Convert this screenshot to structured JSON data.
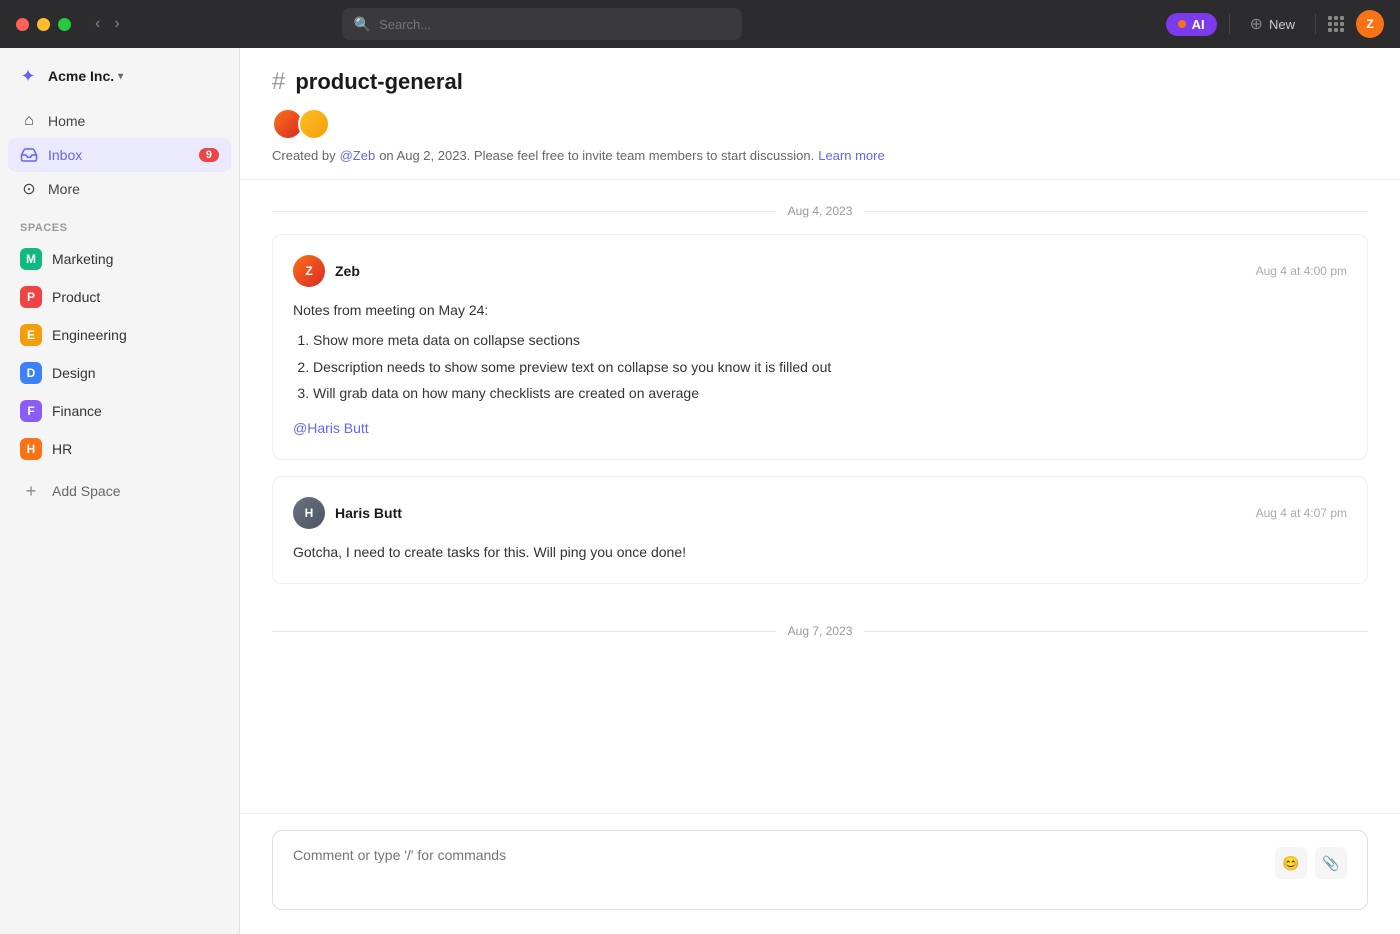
{
  "titlebar": {
    "search_placeholder": "Search...",
    "ai_label": "AI",
    "new_label": "New"
  },
  "sidebar": {
    "workspace_name": "Acme Inc.",
    "nav_items": [
      {
        "id": "home",
        "label": "Home",
        "icon": "house"
      },
      {
        "id": "inbox",
        "label": "Inbox",
        "icon": "inbox",
        "badge": "9",
        "active": true
      },
      {
        "id": "more",
        "label": "More",
        "icon": "more"
      }
    ],
    "spaces_label": "Spaces",
    "spaces": [
      {
        "id": "marketing",
        "label": "Marketing",
        "initial": "M",
        "color": "marketing"
      },
      {
        "id": "product",
        "label": "Product",
        "initial": "P",
        "color": "product"
      },
      {
        "id": "engineering",
        "label": "Engineering",
        "initial": "E",
        "color": "engineering"
      },
      {
        "id": "design",
        "label": "Design",
        "initial": "D",
        "color": "design"
      },
      {
        "id": "finance",
        "label": "Finance",
        "initial": "F",
        "color": "finance"
      },
      {
        "id": "hr",
        "label": "HR",
        "initial": "H",
        "color": "hr"
      }
    ],
    "add_space_label": "Add Space"
  },
  "channel": {
    "name": "product-general",
    "meta_created_by": "Created by ",
    "meta_mention": "@Zeb",
    "meta_on": " on Aug 2, 2023. Please feel free to invite team members to start discussion. ",
    "meta_learn_more": "Learn more"
  },
  "date_groups": [
    {
      "date": "Aug 4, 2023",
      "messages": [
        {
          "author": "Zeb",
          "time": "Aug 4 at 4:00 pm",
          "avatar_class": "zeb-avatar",
          "body_intro": "Notes from meeting on May 24:",
          "list_items": [
            "Show more meta data on collapse sections",
            "Description needs to show some preview text on collapse so you know it is filled out",
            "Will grab data on how many checklists are created on average"
          ],
          "mention": "@Haris Butt",
          "plain_body": null
        },
        {
          "author": "Haris Butt",
          "time": "Aug 4 at 4:07 pm",
          "avatar_class": "haris-avatar",
          "body_intro": null,
          "list_items": [],
          "mention": null,
          "plain_body": "Gotcha, I need to create tasks for this. Will ping you once done!"
        }
      ]
    },
    {
      "date": "Aug 7, 2023",
      "messages": []
    }
  ],
  "comment_box": {
    "placeholder": "Comment or type '/' for commands"
  }
}
